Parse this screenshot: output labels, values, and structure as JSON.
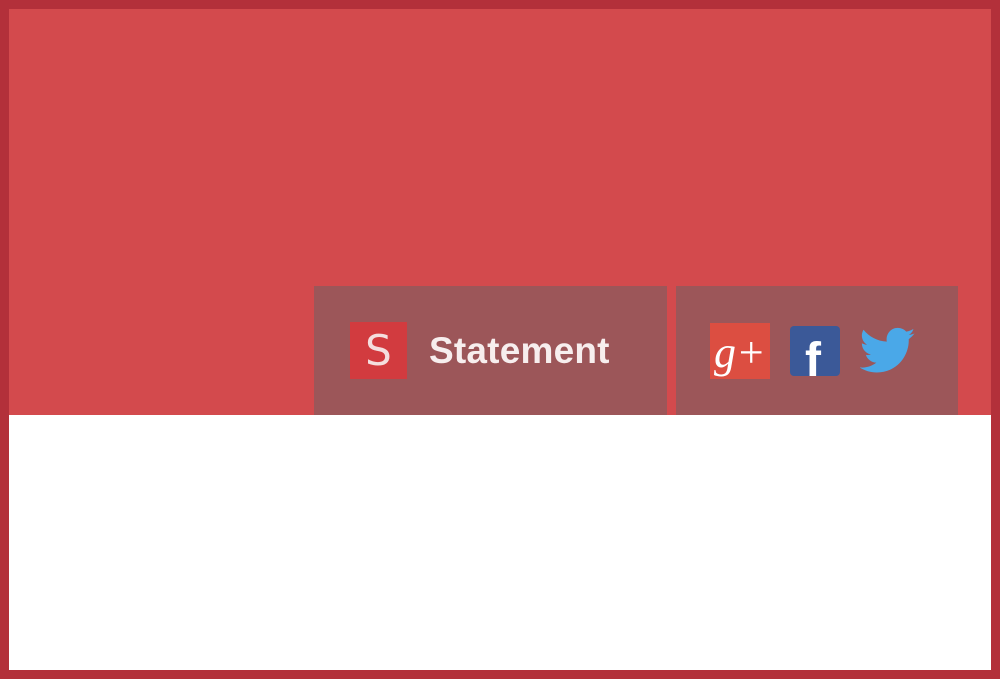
{
  "statement": {
    "badge_letter": "S",
    "label": "Statement"
  },
  "social": {
    "google_plus": {
      "icon": "google-plus-icon",
      "color": "#dc4e41",
      "glyph": "g+"
    },
    "facebook": {
      "icon": "facebook-icon",
      "color": "#3b5998",
      "glyph": "f"
    },
    "twitter": {
      "icon": "twitter-icon",
      "color": "#4aa8e8"
    }
  },
  "colors": {
    "frame_border": "#b3303a",
    "banner": "#d34a4d",
    "panel": "#9c5659"
  }
}
